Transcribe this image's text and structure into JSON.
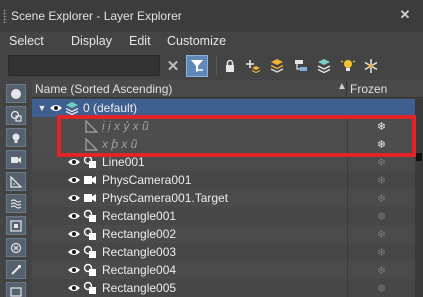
{
  "window": {
    "title": "Scene Explorer - Layer Explorer",
    "close_glyph": "✕"
  },
  "menu": [
    "Select",
    "Display",
    "Edit",
    "Customize"
  ],
  "search": {
    "value": "",
    "placeholder": ""
  },
  "toolbar": {
    "clear_glyph": "✕",
    "buttons": [
      "clear-filter",
      "filter",
      "lock",
      "add-layer",
      "add-to-layer",
      "hierarchy",
      "layers",
      "lightbulb",
      "snowflake"
    ]
  },
  "columns": {
    "name": "Name (Sorted Ascending)",
    "sort_arrow": "▲",
    "frozen": "Frozen"
  },
  "tree": {
    "layer_name": "0 (default)",
    "rows": [
      {
        "label": "ị ị x ỷ x ũ",
        "italic": true
      },
      {
        "label": "x ƥ x ũ",
        "italic": true
      },
      {
        "label": "Line001",
        "italic": false
      },
      {
        "label": "PhysCamera001",
        "italic": false
      },
      {
        "label": "PhysCamera001.Target",
        "italic": false
      },
      {
        "label": "Rectangle001",
        "italic": false
      },
      {
        "label": "Rectangle002",
        "italic": false
      },
      {
        "label": "Rectangle003",
        "italic": false
      },
      {
        "label": "Rectangle004",
        "italic": false
      },
      {
        "label": "Rectangle005",
        "italic": false
      }
    ],
    "expand_glyph": "▼",
    "frozen_glyph": "❄"
  },
  "colors": {
    "accent": "#5f88b8",
    "highlight": "#e0242a",
    "layer_row": "#3e5f8f"
  }
}
